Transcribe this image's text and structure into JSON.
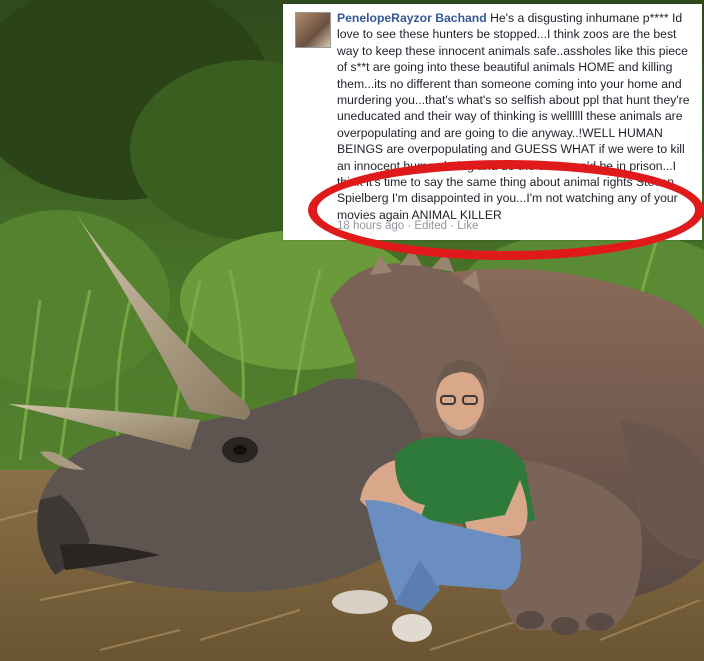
{
  "comment": {
    "author": "PenelopeRayzor Bachand",
    "body": "He's a disgusting inhumane p**** Id love to see these hunters be stopped...I think zoos are the best way to keep these innocent animals safe..assholes like this piece of s**t are going into these beautiful animals HOME and killing them...its no different than someone coming into your home and murdering you...that's what's so selfish about ppl that hunt they're uneducated and their way of thinking is wellllll these animals are overpopulating and are going to die anyway..!WELL HUMAN BEINGS are overpopulating and GUESS WHAT if we were to kill an innocent human being and do the same we'd be in prison...I think it's time to say the same thing about animal rights Steven Spielberg I'm disappointed in you...I'm not watching any of your movies again ANIMAL KILLER",
    "timestamp": "18 hours ago",
    "separator": "·",
    "edited_label": "Edited",
    "like_label": "Like"
  },
  "colors": {
    "author": "#365899",
    "text": "#1d2129",
    "meta": "#90949c",
    "highlight_ring": "#e01a1a"
  }
}
